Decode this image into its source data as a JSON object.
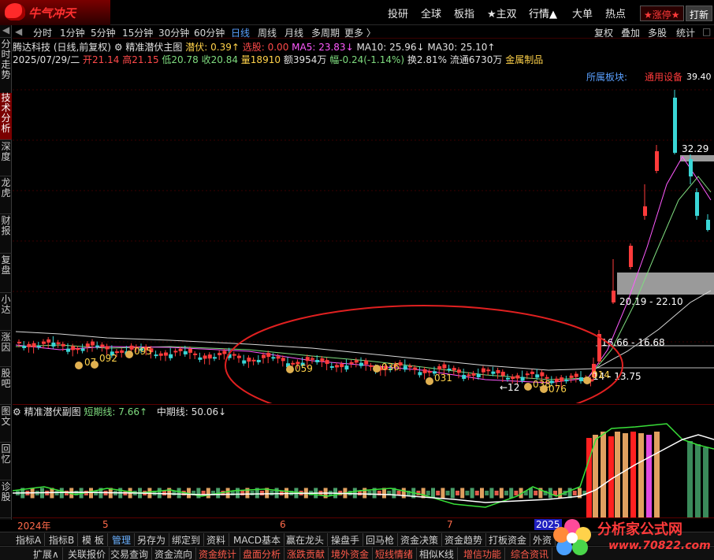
{
  "app": {
    "logo_text": "牛气冲天"
  },
  "top_nav": {
    "items": [
      "投研",
      "全球",
      "板指",
      "★主双",
      "行情▲",
      "大单",
      "热点"
    ],
    "limit_up_button": "★涨停★",
    "hit_button": "打新"
  },
  "left_tabs": [
    "分时走势",
    "技术分析",
    "深度",
    "龙虎",
    "财报",
    "复盘",
    "小达",
    "涨因",
    "股吧",
    "图文",
    "回忆",
    "诊股"
  ],
  "period_bar": {
    "periods": [
      "分时",
      "1分钟",
      "5分钟",
      "15分钟",
      "30分钟",
      "60分钟",
      "日线",
      "周线",
      "月线",
      "多周期",
      "更多 〉"
    ],
    "active": "日线",
    "right_tools": [
      "复权",
      "叠加",
      "多股",
      "统计"
    ]
  },
  "info": {
    "stock": "腾达科技 (日线,前复权)",
    "indicator": "精准潜伏主图",
    "qianfu_label": "潜伏:",
    "qianfu_value": "0.39↑",
    "xuangu_label": "选股:",
    "xuangu_value": "0.00",
    "ma5": "MA5: 23.83↓",
    "ma10": "MA10: 25.96↓",
    "ma30": "MA30: 25.10↑",
    "date": "2025/07/29/二",
    "open": "开21.14",
    "high": "高21.15",
    "low": "低20.78",
    "close": "收20.84",
    "volume": "量18910",
    "amount": "额3954万",
    "change": "幅-0.24(-1.14%)",
    "turnover": "换2.81%",
    "float": "流通6730万",
    "sector": "金属制品",
    "board_label": "所属板块:",
    "board_value": "通用设备"
  },
  "price_labels": {
    "peak": "39.40",
    "mid_high": "32.29",
    "zone1": "20.19 - 22.10",
    "zone2": "16.66 - 16.68",
    "zone3": "14 - 13.75",
    "low_tag": "←12",
    "bag_092": "092",
    "bag_07": "07",
    "bag_095": "095",
    "bag_059": "059",
    "bag_036": "036",
    "bag_031": "031",
    "bag_038": "038",
    "bag_076": "076",
    "bag_014": "014"
  },
  "colors": {
    "up": "#ff3b3b",
    "down": "#3ad6d6",
    "ma5": "#e0e0e0",
    "ma10": "#ff5aff",
    "ma30": "#7fdc7f",
    "accent": "#7a0000"
  },
  "sub_header": {
    "indicator": "精准潜伏副图",
    "short_label": "短期线:",
    "short_value": "7.66↑",
    "mid_label": "中期线:",
    "mid_value": "50.06↓"
  },
  "date_axis": [
    "2024年",
    "5",
    "6",
    "7",
    "2025"
  ],
  "bottom_tabs_1": [
    "指标A",
    "指标B",
    "模 板",
    "管理",
    "另存为",
    "绑定到",
    "资料",
    "MACD基本",
    "赢在龙头",
    "操盘手",
    "回马枪",
    "资金决策",
    "资金趋势",
    "打板资金",
    "外资"
  ],
  "bottom_tabs_2": [
    "扩展∧",
    "关联报价",
    "交易查询",
    "资金流向",
    "资金统计",
    "盘面分析",
    "涨跌贡献",
    "境外资金",
    "短线情绪",
    "相似K线",
    "增信功能",
    "综合资讯"
  ],
  "watermark": {
    "title": "分析家公式网",
    "url": "www.70822.com"
  }
}
